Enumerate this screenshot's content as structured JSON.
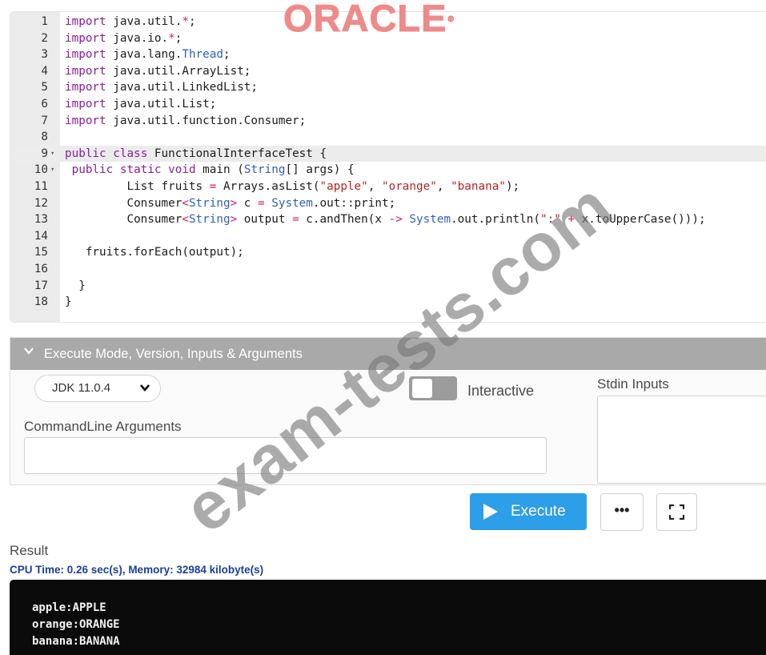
{
  "editor": {
    "lines": [
      {
        "n": "1",
        "fold": ""
      },
      {
        "n": "2",
        "fold": ""
      },
      {
        "n": "3",
        "fold": ""
      },
      {
        "n": "4",
        "fold": ""
      },
      {
        "n": "5",
        "fold": ""
      },
      {
        "n": "6",
        "fold": ""
      },
      {
        "n": "7",
        "fold": ""
      },
      {
        "n": "8",
        "fold": ""
      },
      {
        "n": "9",
        "fold": "▾"
      },
      {
        "n": "10",
        "fold": "▾"
      },
      {
        "n": "11",
        "fold": ""
      },
      {
        "n": "12",
        "fold": ""
      },
      {
        "n": "13",
        "fold": ""
      },
      {
        "n": "14",
        "fold": ""
      },
      {
        "n": "15",
        "fold": ""
      },
      {
        "n": "16",
        "fold": ""
      },
      {
        "n": "17",
        "fold": ""
      },
      {
        "n": "18",
        "fold": ""
      }
    ],
    "code": [
      "import java.util.*;",
      "import java.io.*;",
      "import java.lang.Thread;",
      "import java.util.ArrayList;",
      "import java.util.LinkedList;",
      "import java.util.List;",
      "import java.util.function.Consumer;",
      "",
      "public class FunctionalInterfaceTest {",
      " public static void main (String[] args) {",
      "         List fruits = Arrays.asList(\"apple\", \"orange\", \"banana\");",
      "         Consumer<String> c = System.out::print;",
      "         Consumer<String> output = c.andThen(x -> System.out.println(\":\" + x.toUpperCase()));",
      "",
      "   fruits.forEach(output);",
      "",
      "  }",
      "}"
    ]
  },
  "logo": {
    "text": "ORACLE",
    "reg": "®"
  },
  "exec_panel": {
    "header": "Execute Mode, Version, Inputs & Arguments",
    "jdk_version": "JDK 11.0.4",
    "interactive_label": "Interactive",
    "interactive_on": false,
    "stdin_label": "Stdin Inputs",
    "cmd_label": "CommandLine Arguments"
  },
  "actions": {
    "execute_label": "Execute",
    "more_label": "•••"
  },
  "result": {
    "title": "Result",
    "cpu": "CPU Time: 0.26 sec(s), Memory: 32984 kilobyte(s)",
    "output": [
      "apple:APPLE",
      "orange:ORANGE",
      "banana:BANANA"
    ]
  },
  "watermark": "exam-tests.com",
  "colors": {
    "execute": "#2d9ee8",
    "header_bar": "#a9a9a9",
    "keyword": "#8a1d9c",
    "string": "#b52424"
  }
}
